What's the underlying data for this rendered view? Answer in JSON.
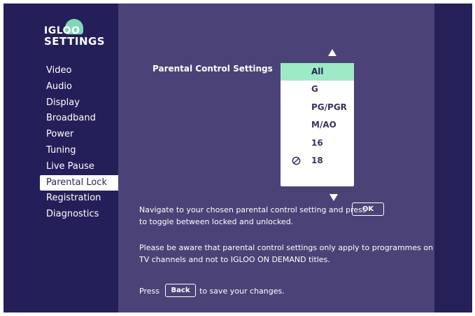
{
  "logo": {
    "line1": "IGLOO",
    "line2": "SETTINGS"
  },
  "menu": {
    "items": [
      {
        "label": "Video"
      },
      {
        "label": "Audio"
      },
      {
        "label": "Display"
      },
      {
        "label": "Broadband"
      },
      {
        "label": "Power"
      },
      {
        "label": "Tuning"
      },
      {
        "label": "Live Pause"
      },
      {
        "label": "Parental Lock"
      },
      {
        "label": "Registration"
      },
      {
        "label": "Diagnostics"
      }
    ],
    "active": "Parental Lock"
  },
  "main": {
    "title": "Parental Control Settings",
    "ratings": [
      {
        "label": "All",
        "selected": true,
        "locked": false
      },
      {
        "label": "G",
        "selected": false,
        "locked": false
      },
      {
        "label": "PG/PGR",
        "selected": false,
        "locked": false
      },
      {
        "label": "M/AO",
        "selected": false,
        "locked": false
      },
      {
        "label": "16",
        "selected": false,
        "locked": false
      },
      {
        "label": "18",
        "selected": false,
        "locked": true
      }
    ],
    "instruction_line1": "Navigate to your chosen parental control setting and press",
    "ok_key": "OK",
    "instruction_line2": "to toggle between locked and unlocked.",
    "note_line1": "Please be aware that parental control settings only apply to programmes on",
    "note_line2": "TV channels and not to IGLOO ON DEMAND titles.",
    "press_label": "Press",
    "back_key": "Back",
    "save_label": "to save your changes."
  },
  "colors": {
    "sidebar_bg": "#241f58",
    "main_bg": "#4b4377",
    "selected_bg": "#9ee9c6",
    "logo_accent": "#7fd8b8"
  },
  "icons": {
    "up": "up-arrow-icon",
    "down": "down-arrow-icon",
    "lock": "locked-icon"
  }
}
